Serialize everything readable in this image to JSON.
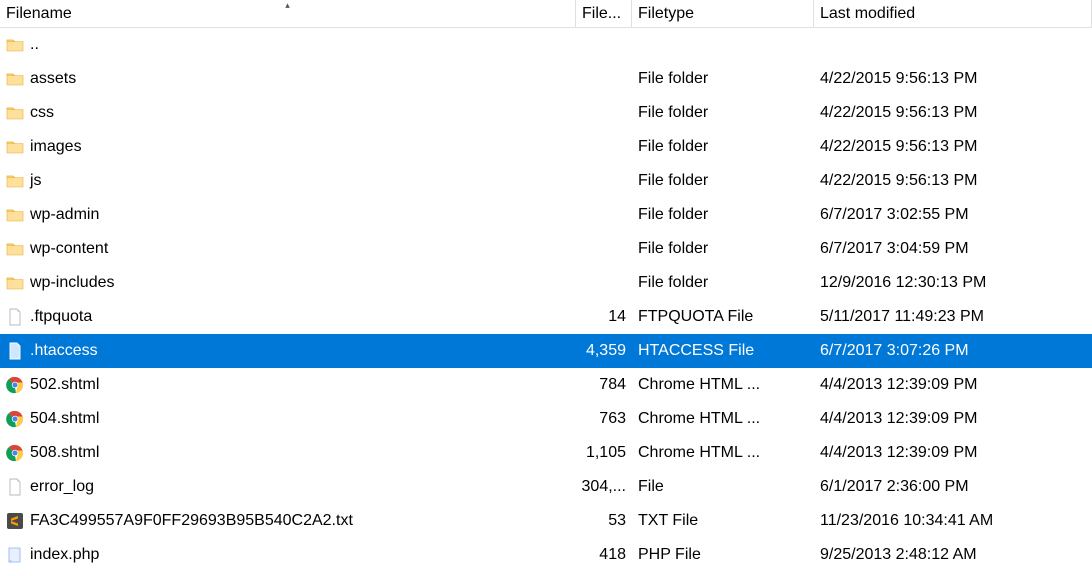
{
  "columns": {
    "filename": "Filename",
    "filesize": "File...",
    "filetype": "Filetype",
    "modified": "Last modified"
  },
  "sort": {
    "column": "filename",
    "direction": "asc"
  },
  "rows": [
    {
      "icon": "folder",
      "name": "..",
      "size": "",
      "type": "",
      "modified": "",
      "selected": false
    },
    {
      "icon": "folder",
      "name": "assets",
      "size": "",
      "type": "File folder",
      "modified": "4/22/2015 9:56:13 PM",
      "selected": false
    },
    {
      "icon": "folder",
      "name": "css",
      "size": "",
      "type": "File folder",
      "modified": "4/22/2015 9:56:13 PM",
      "selected": false
    },
    {
      "icon": "folder",
      "name": "images",
      "size": "",
      "type": "File folder",
      "modified": "4/22/2015 9:56:13 PM",
      "selected": false
    },
    {
      "icon": "folder",
      "name": "js",
      "size": "",
      "type": "File folder",
      "modified": "4/22/2015 9:56:13 PM",
      "selected": false
    },
    {
      "icon": "folder",
      "name": "wp-admin",
      "size": "",
      "type": "File folder",
      "modified": "6/7/2017 3:02:55 PM",
      "selected": false
    },
    {
      "icon": "folder",
      "name": "wp-content",
      "size": "",
      "type": "File folder",
      "modified": "6/7/2017 3:04:59 PM",
      "selected": false
    },
    {
      "icon": "folder",
      "name": "wp-includes",
      "size": "",
      "type": "File folder",
      "modified": "12/9/2016 12:30:13 PM",
      "selected": false
    },
    {
      "icon": "file",
      "name": ".ftpquota",
      "size": "14",
      "type": "FTPQUOTA File",
      "modified": "5/11/2017 11:49:23 PM",
      "selected": false
    },
    {
      "icon": "file",
      "name": ".htaccess",
      "size": "4,359",
      "type": "HTACCESS File",
      "modified": "6/7/2017 3:07:26 PM",
      "selected": true
    },
    {
      "icon": "chrome",
      "name": "502.shtml",
      "size": "784",
      "type": "Chrome HTML ...",
      "modified": "4/4/2013 12:39:09 PM",
      "selected": false
    },
    {
      "icon": "chrome",
      "name": "504.shtml",
      "size": "763",
      "type": "Chrome HTML ...",
      "modified": "4/4/2013 12:39:09 PM",
      "selected": false
    },
    {
      "icon": "chrome",
      "name": "508.shtml",
      "size": "1,105",
      "type": "Chrome HTML ...",
      "modified": "4/4/2013 12:39:09 PM",
      "selected": false
    },
    {
      "icon": "file",
      "name": "error_log",
      "size": "304,...",
      "type": "File",
      "modified": "6/1/2017 2:36:00 PM",
      "selected": false
    },
    {
      "icon": "sublime",
      "name": "FA3C499557A9F0FF29693B95B540C2A2.txt",
      "size": "53",
      "type": "TXT File",
      "modified": "11/23/2016 10:34:41 AM",
      "selected": false
    },
    {
      "icon": "php",
      "name": "index.php",
      "size": "418",
      "type": "PHP File",
      "modified": "9/25/2013 2:48:12 AM",
      "selected": false
    }
  ]
}
